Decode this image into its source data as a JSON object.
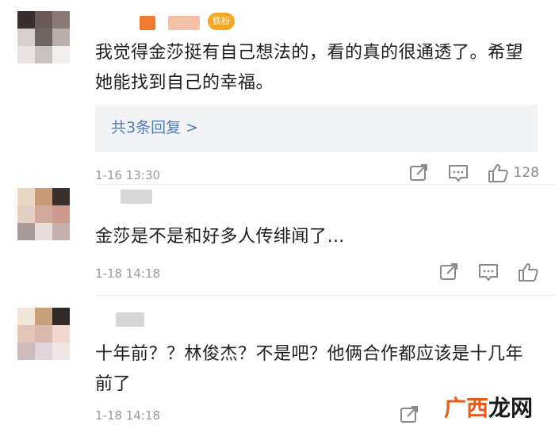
{
  "comments": [
    {
      "text": "我觉得金莎挺有自己想法的，看的真的很通透了。希望她能找到自己的幸福。",
      "reply_label": "共3条回复 >",
      "time": "1-16 13:30",
      "like_count": "128",
      "badge": "铁粉"
    },
    {
      "text": "金莎是不是和好多人传绯闻了…",
      "time": "1-18 14:18",
      "like_count": ""
    },
    {
      "text": "十年前？？林俊杰？不是吧？他俩合作都应该是十几年前了",
      "time": "1-18 14:18",
      "like_count": ""
    }
  ],
  "icons": [
    "share-icon",
    "comment-icon",
    "like-icon"
  ],
  "colors": {
    "link": "#4f7cb8",
    "meta": "#9a9a9a",
    "reply_bg": "#f2f3f5",
    "badge": "#f5a623"
  },
  "watermark": {
    "part1": "广西",
    "part2": "龙网"
  }
}
